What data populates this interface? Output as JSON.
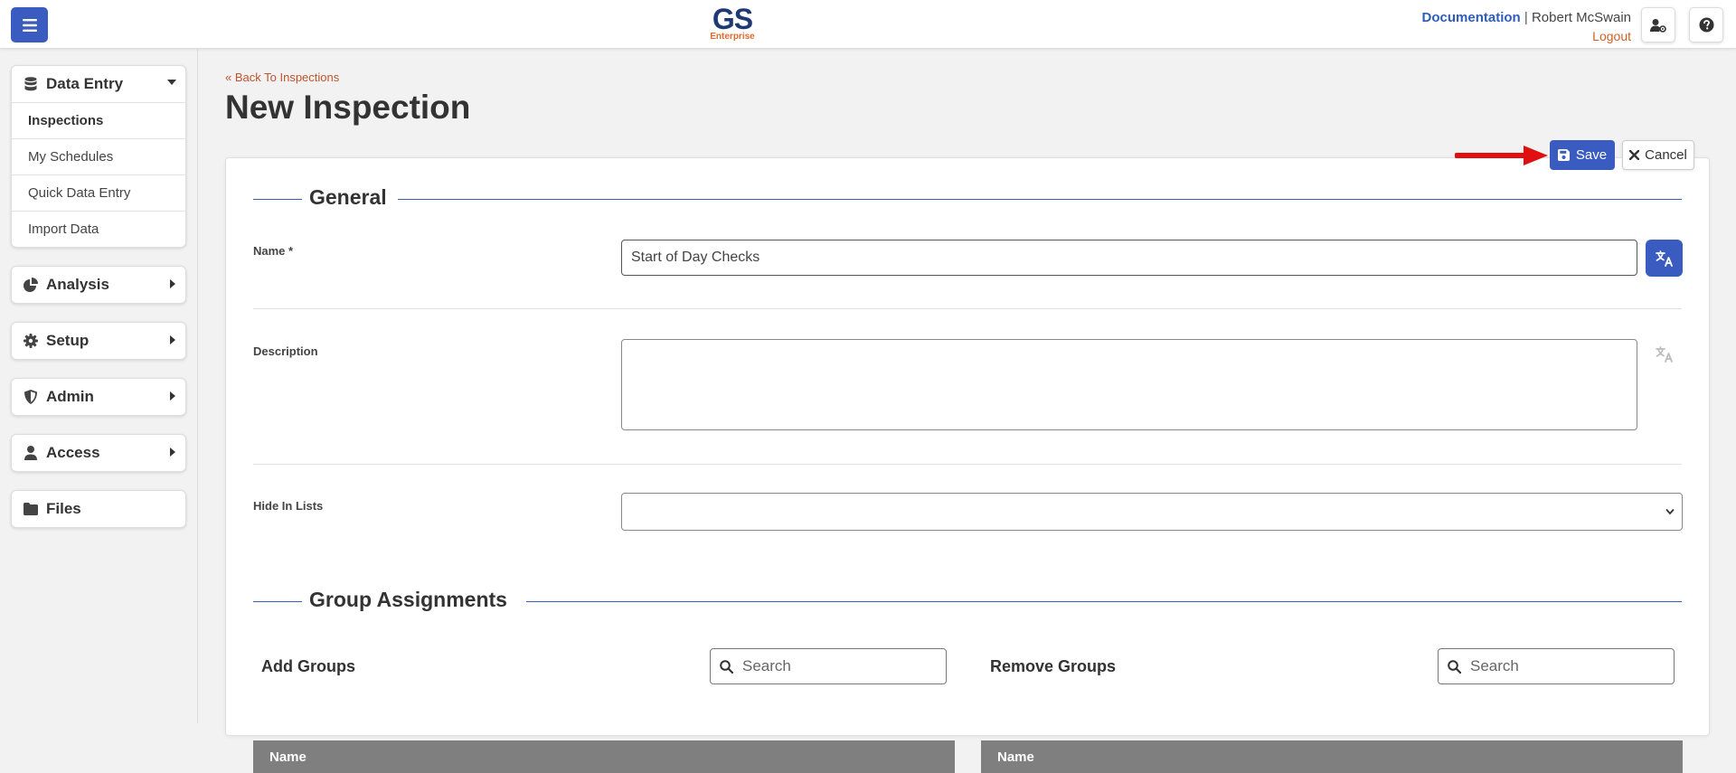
{
  "header": {
    "logo_text": "GS",
    "logo_sub": "Enterprise",
    "documentation_link": "Documentation",
    "separator": "|",
    "user_name": "Robert McSwain",
    "logout": "Logout"
  },
  "sidebar": {
    "data_entry": {
      "label": "Data Entry",
      "items": [
        {
          "label": "Inspections",
          "active": true
        },
        {
          "label": "My Schedules"
        },
        {
          "label": "Quick Data Entry"
        },
        {
          "label": "Import Data"
        }
      ]
    },
    "analysis": {
      "label": "Analysis"
    },
    "setup": {
      "label": "Setup"
    },
    "admin": {
      "label": "Admin"
    },
    "access": {
      "label": "Access"
    },
    "files": {
      "label": "Files"
    }
  },
  "page": {
    "back_link": "Back To Inspections",
    "title": "New Inspection",
    "save_label": "Save",
    "cancel_label": "Cancel"
  },
  "general": {
    "section_title": "General",
    "name_label": "Name *",
    "name_value": "Start of Day Checks",
    "description_label": "Description",
    "description_value": "",
    "hide_in_lists_label": "Hide In Lists",
    "hide_in_lists_value": ""
  },
  "groups": {
    "section_title": "Group Assignments",
    "add_title": "Add Groups",
    "remove_title": "Remove Groups",
    "search_placeholder": "Search",
    "column_name": "Name"
  },
  "colors": {
    "primary": "#3a5cc0",
    "accent_orange": "#d2602a",
    "table_header": "#7f7f7f"
  }
}
